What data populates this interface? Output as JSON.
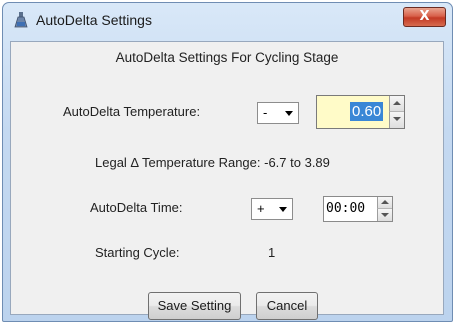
{
  "window": {
    "title": "AutoDelta Settings",
    "close_glyph": "X"
  },
  "dialog": {
    "heading": "AutoDelta Settings For Cycling Stage",
    "temperature": {
      "label": "AutoDelta Temperature:",
      "sign": "-",
      "value": "0.60",
      "range_text": "Legal Δ Temperature Range: -6.7 to 3.89"
    },
    "time": {
      "label": "AutoDelta Time:",
      "sign": "+",
      "value": "00:00"
    },
    "starting_cycle": {
      "label": "Starting Cycle:",
      "value": "1"
    },
    "buttons": {
      "save": "Save Setting",
      "cancel": "Cancel"
    }
  },
  "icons": {
    "app": "flask-icon",
    "close": "close-icon",
    "dropdown": "chevron-down-icon",
    "spin_up": "arrow-up-icon",
    "spin_down": "arrow-down-icon"
  },
  "colors": {
    "title_bar": "#c4d9f1",
    "close_button": "#c9432d",
    "client_background": "#f0f0f0",
    "temperature_field": "#fffbc8",
    "selection": "#3a87d6"
  }
}
